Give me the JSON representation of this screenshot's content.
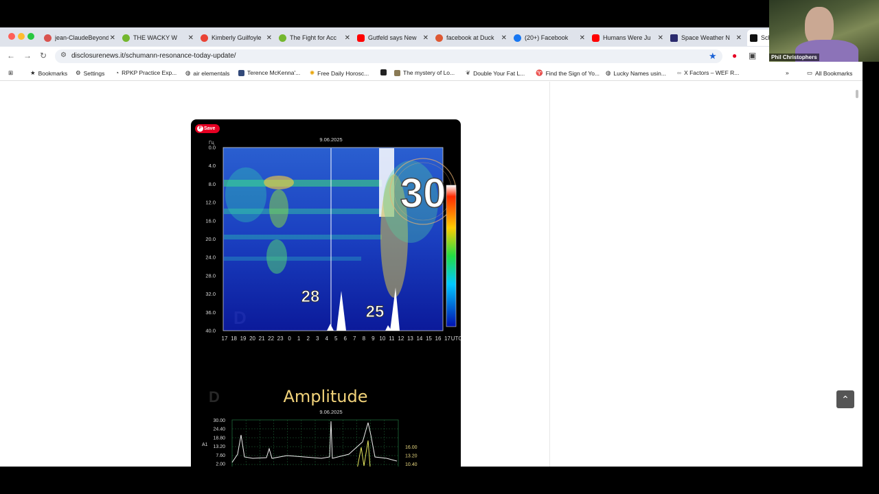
{
  "tabs": [
    {
      "label": "jean-ClaudeBeyond",
      "icon": "dharma-icon",
      "color": "#d9534f"
    },
    {
      "label": "THE WACKY W",
      "icon": "rumble-icon",
      "color": "#74b72e"
    },
    {
      "label": "Kimberly Guilfoyle",
      "icon": "gmail-icon",
      "color": "#ea4335"
    },
    {
      "label": "The Fight for Acc",
      "icon": "rumble-icon",
      "color": "#74b72e"
    },
    {
      "label": "Gutfeld says New",
      "icon": "youtube-icon",
      "color": "#ff0000"
    },
    {
      "label": "facebook at Duck",
      "icon": "duckduckgo-icon",
      "color": "#de5833"
    },
    {
      "label": "(20+) Facebook",
      "icon": "facebook-icon",
      "color": "#1877f2"
    },
    {
      "label": "Humans Were Ju",
      "icon": "youtube-icon",
      "color": "#ff0000"
    },
    {
      "label": "Space Weather N",
      "icon": "space-weather-icon",
      "color": "#2b2b6e"
    },
    {
      "label": "Sch",
      "icon": "disclosure-icon",
      "color": "#111111"
    }
  ],
  "nav": {
    "url": "disclosurenews.it/schumann-resonance-today-update/"
  },
  "bookmarks": [
    {
      "label": "Bookmarks",
      "icon": "star-icon"
    },
    {
      "label": "Settings",
      "icon": "gear-icon"
    },
    {
      "label": "RPKP Practice Exp...",
      "icon": "rpkp-icon"
    },
    {
      "label": "air elementals",
      "icon": "globe-icon"
    },
    {
      "label": "Terence McKenna'...",
      "icon": "image-icon"
    },
    {
      "label": "Free Daily Horosc...",
      "icon": "sun-icon"
    },
    {
      "label": "",
      "icon": "m-icon"
    },
    {
      "label": "The mystery of Lo...",
      "icon": "document-icon"
    },
    {
      "label": "Double Your Fat L...",
      "icon": "leaf-icon"
    },
    {
      "label": "Find the Sign of Yo...",
      "icon": "sign-icon"
    },
    {
      "label": "Lucky Names usin...",
      "icon": "globe-icon"
    },
    {
      "label": "X Factors – WEF R...",
      "icon": "x-icon"
    },
    {
      "label": "All Bookmarks",
      "icon": "folder-icon"
    }
  ],
  "webcam": {
    "name": "Phil Christophers"
  },
  "pin": {
    "save_label": "Save"
  },
  "spectrogram": {
    "date": "9.06.2025",
    "unit_hz": "Hz",
    "unit_gc": "Гц",
    "y_ticks": [
      "0.0",
      "4.0",
      "8.0",
      "12.0",
      "16.0",
      "20.0",
      "24.0",
      "28.0",
      "32.0",
      "36.0",
      "40.0"
    ],
    "x_ticks": [
      "17",
      "18",
      "19",
      "20",
      "21",
      "22",
      "23",
      "0",
      "1",
      "2",
      "3",
      "4",
      "5",
      "6",
      "7",
      "8",
      "9",
      "10",
      "11",
      "12",
      "13",
      "14",
      "15",
      "16",
      "17",
      "UTC"
    ],
    "big_numbers": [
      "30",
      "28",
      "25"
    ]
  },
  "amplitude": {
    "title": "Amplitude",
    "date": "9.06.2025",
    "axis_label": "A1",
    "left_ticks": [
      "30.00",
      "24.40",
      "18.80",
      "13.20",
      "7.60",
      "2.00"
    ],
    "right_ticks": [
      "16.00",
      "13.20",
      "10.40"
    ]
  },
  "colors": {
    "accent": "#1a62d6",
    "pinterest": "#e60023",
    "tab_strip": "#dfe3eb"
  }
}
